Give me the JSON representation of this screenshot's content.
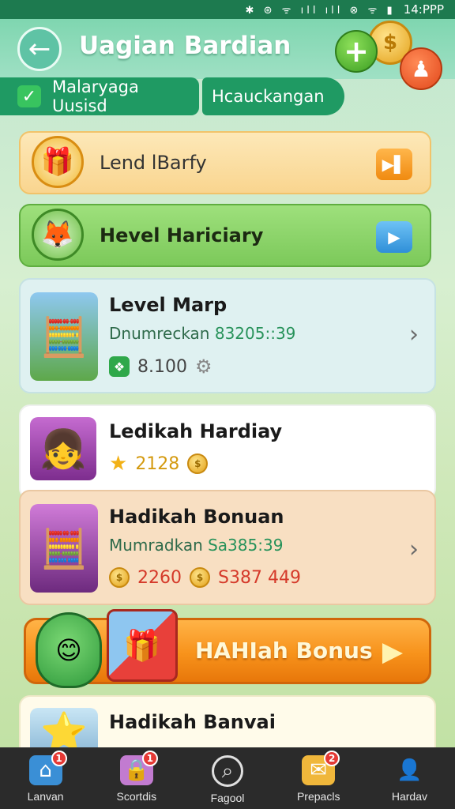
{
  "status": {
    "time": "14:PPP",
    "icons": "✱ ⊛ ᯤ ıll ıll ⊗ ᯤ ▮"
  },
  "header": {
    "title": "Uagian Bardian"
  },
  "tabs": [
    {
      "label": "Malaryaga Uusisd"
    },
    {
      "label": "Hcauckangan"
    }
  ],
  "banners": [
    {
      "label": "Lend lBarfy"
    },
    {
      "label": "Hevel Hariciary"
    }
  ],
  "cards": [
    {
      "title": "Level Marp",
      "subtitle_text": "Dnumreckan",
      "subtitle_num": "83205::39",
      "meta_value": "8.100"
    },
    {
      "title": "Ledikah Hardiay",
      "meta_value": "2128"
    },
    {
      "title": "Hadikah Bonuan",
      "subtitle_text": "Mumradkan",
      "subtitle_num": "Sa385:39",
      "meta_value": "2260",
      "meta_value2": "S387 449"
    },
    {
      "title": "Hadikah Banvai"
    }
  ],
  "cta": {
    "label": "HAHIah Bonus"
  },
  "nav": [
    {
      "label": "Lanvan",
      "badge": "1"
    },
    {
      "label": "Scortdis",
      "badge": "1"
    },
    {
      "label": "Fagool"
    },
    {
      "label": "Prepacls",
      "badge": "2"
    },
    {
      "label": "Hardav"
    }
  ],
  "colors": {
    "brand_green": "#1f9a63",
    "cta_orange": "#f7921b",
    "nav_bg": "#2b2b2b"
  }
}
